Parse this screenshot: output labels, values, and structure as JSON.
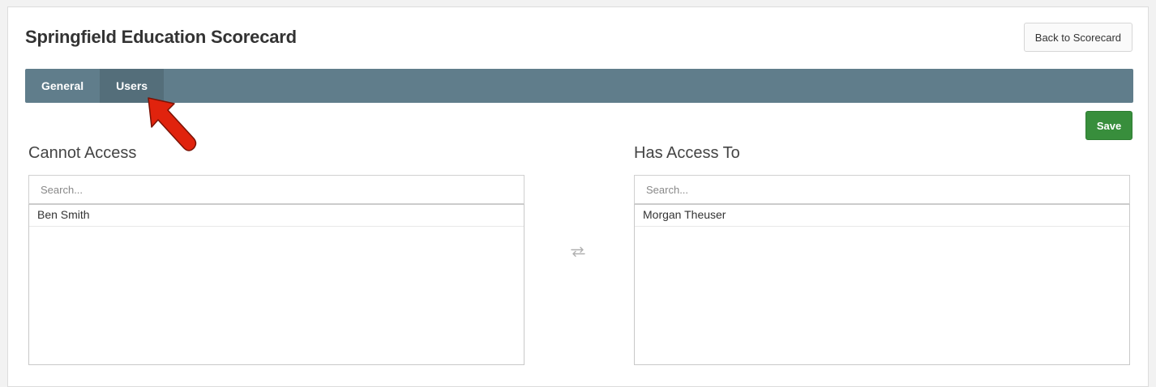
{
  "page": {
    "title": "Springfield Education Scorecard",
    "back_button_label": "Back to Scorecard",
    "save_button_label": "Save"
  },
  "tabs": [
    {
      "label": "General",
      "active": false
    },
    {
      "label": "Users",
      "active": true
    }
  ],
  "cannot_access": {
    "heading": "Cannot Access",
    "search_placeholder": "Search...",
    "items": [
      "Ben Smith"
    ]
  },
  "has_access": {
    "heading": "Has Access To",
    "search_placeholder": "Search...",
    "items": [
      "Morgan Theuser"
    ]
  },
  "icons": {
    "transfer": "swap-arrows-icon",
    "annotation": "red-pointer-arrow-icon"
  },
  "colors": {
    "tabbar": "#607d8b",
    "tab_active": "#546e7a",
    "save_button": "#388e3c",
    "annotation_arrow": "#e0230d"
  }
}
